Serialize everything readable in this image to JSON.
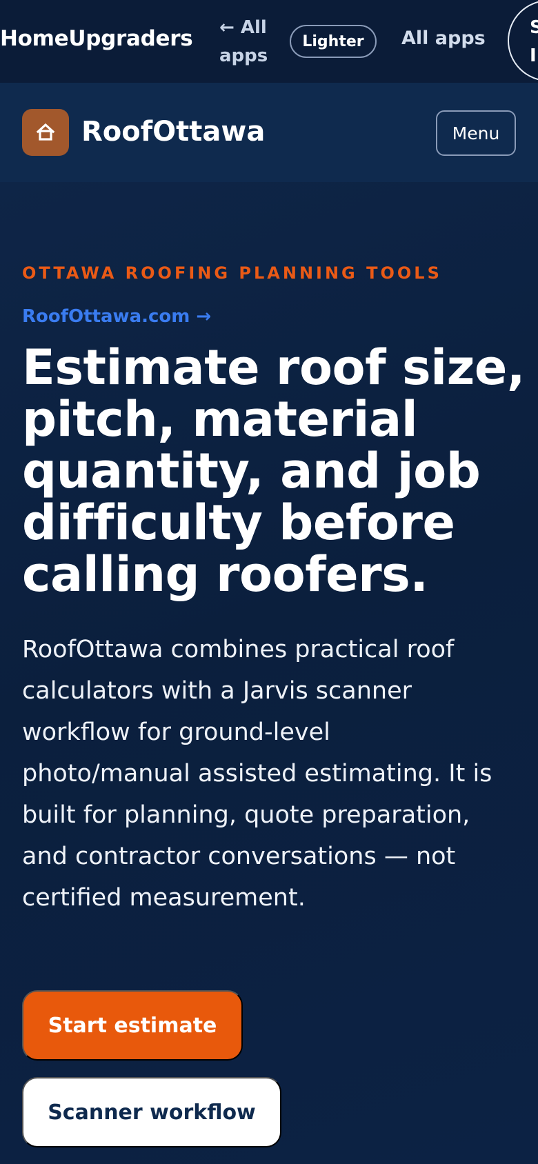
{
  "topbar": {
    "brand": "HomeUpgraders",
    "back_link": "← All apps",
    "theme_button": "Lighter",
    "all_apps": "All apps",
    "signin_partial": "S\nI"
  },
  "site_header": {
    "logo_icon": "house-icon",
    "logo_glyph": "⌂",
    "name": "RoofOttawa",
    "menu_button": "Menu"
  },
  "hero": {
    "eyebrow": "OTTAWA ROOFING PLANNING TOOLS",
    "domain_link": "RoofOttawa.com →",
    "headline": "Estimate roof size, pitch, material quantity, and job difficulty before calling roofers.",
    "description": "RoofOttawa combines practical roof calculators with a Jarvis scanner workflow for ground-level photo/manual assisted estimating. It is built for planning, quote preparation, and contractor conversations — not certified measurement.",
    "primary_cta": "Start estimate",
    "secondary_cta": "Scanner workflow"
  },
  "colors": {
    "accent": "#e8590c",
    "link": "#3a7cf0",
    "background": "#0b1f3d",
    "logo_bg": "#a2582c"
  }
}
